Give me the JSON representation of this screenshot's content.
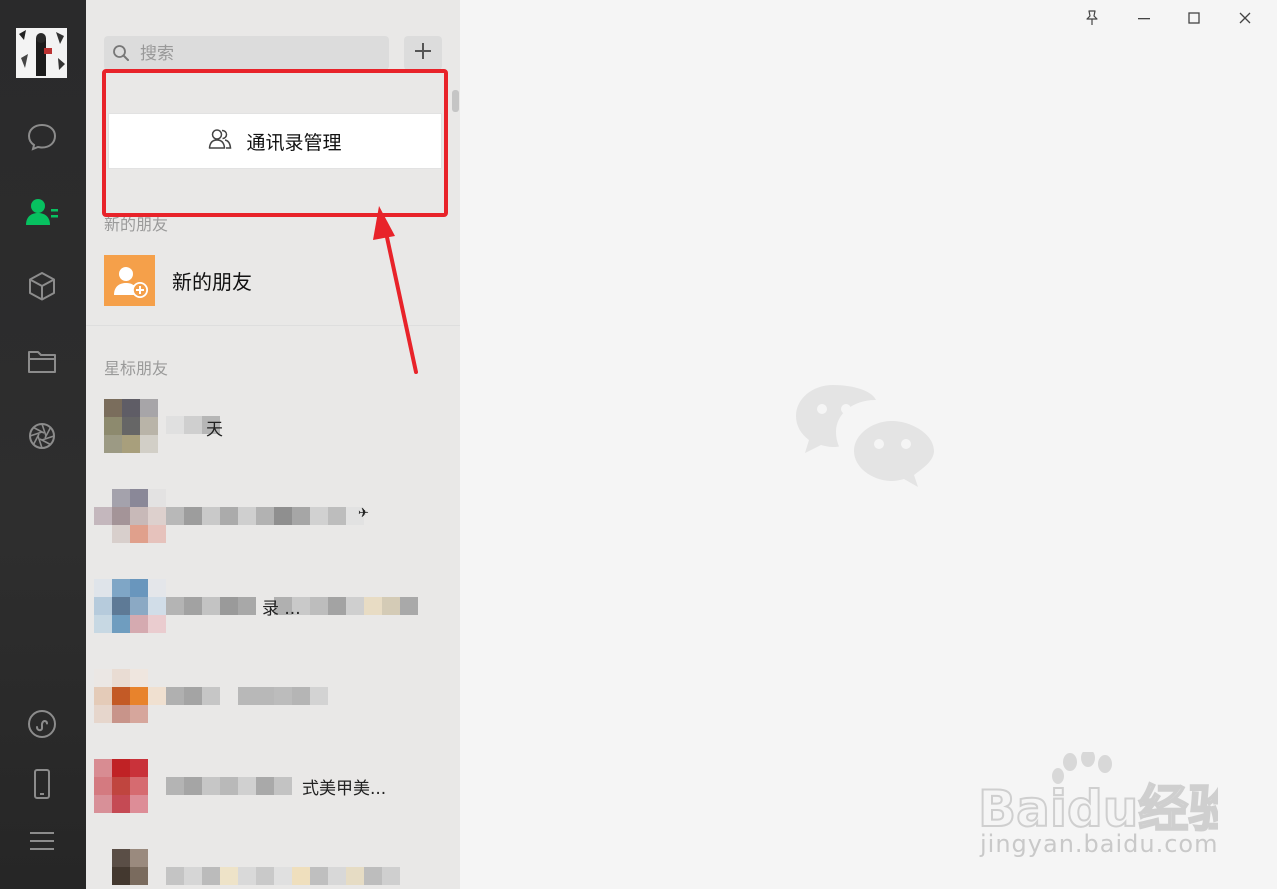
{
  "search": {
    "placeholder": "搜索"
  },
  "toolbar": {
    "add_label": "+"
  },
  "contacts_manage": {
    "label": "通讯录管理"
  },
  "sections": {
    "new_friends": "新的朋友",
    "starred": "星标朋友"
  },
  "new_friend_item": {
    "label": "新的朋友"
  },
  "contacts": [
    {
      "visible_text": "天"
    },
    {
      "visible_text": "✈"
    },
    {
      "visible_text": "录 ..."
    },
    {
      "visible_text": ""
    },
    {
      "visible_text": "式美甲美..."
    },
    {
      "visible_text": ""
    }
  ],
  "watermark": {
    "brand": "Baidu经验",
    "url": "jingyan.baidu.com"
  },
  "colors": {
    "rail_bg": "#2e2e2e",
    "active_green": "#07c160",
    "highlight_red": "#e8232a",
    "new_friend_orange": "#f5a04a"
  },
  "icons": {
    "rail": [
      "chat-icon",
      "contacts-icon",
      "cube-icon",
      "folder-icon",
      "moments-icon",
      "mini-program-icon",
      "phone-icon",
      "menu-icon"
    ],
    "window": [
      "pin-icon",
      "minimize-icon",
      "maximize-icon",
      "close-icon"
    ]
  }
}
